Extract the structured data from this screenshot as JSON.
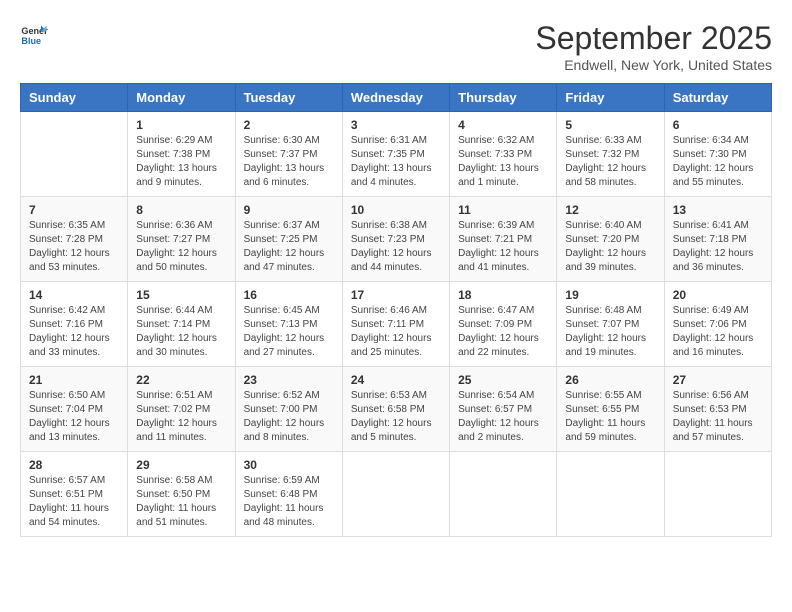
{
  "header": {
    "logo_general": "General",
    "logo_blue": "Blue",
    "title": "September 2025",
    "subtitle": "Endwell, New York, United States"
  },
  "days_of_week": [
    "Sunday",
    "Monday",
    "Tuesday",
    "Wednesday",
    "Thursday",
    "Friday",
    "Saturday"
  ],
  "weeks": [
    [
      {
        "day": "",
        "info": ""
      },
      {
        "day": "1",
        "info": "Sunrise: 6:29 AM\nSunset: 7:38 PM\nDaylight: 13 hours\nand 9 minutes."
      },
      {
        "day": "2",
        "info": "Sunrise: 6:30 AM\nSunset: 7:37 PM\nDaylight: 13 hours\nand 6 minutes."
      },
      {
        "day": "3",
        "info": "Sunrise: 6:31 AM\nSunset: 7:35 PM\nDaylight: 13 hours\nand 4 minutes."
      },
      {
        "day": "4",
        "info": "Sunrise: 6:32 AM\nSunset: 7:33 PM\nDaylight: 13 hours\nand 1 minute."
      },
      {
        "day": "5",
        "info": "Sunrise: 6:33 AM\nSunset: 7:32 PM\nDaylight: 12 hours\nand 58 minutes."
      },
      {
        "day": "6",
        "info": "Sunrise: 6:34 AM\nSunset: 7:30 PM\nDaylight: 12 hours\nand 55 minutes."
      }
    ],
    [
      {
        "day": "7",
        "info": "Sunrise: 6:35 AM\nSunset: 7:28 PM\nDaylight: 12 hours\nand 53 minutes."
      },
      {
        "day": "8",
        "info": "Sunrise: 6:36 AM\nSunset: 7:27 PM\nDaylight: 12 hours\nand 50 minutes."
      },
      {
        "day": "9",
        "info": "Sunrise: 6:37 AM\nSunset: 7:25 PM\nDaylight: 12 hours\nand 47 minutes."
      },
      {
        "day": "10",
        "info": "Sunrise: 6:38 AM\nSunset: 7:23 PM\nDaylight: 12 hours\nand 44 minutes."
      },
      {
        "day": "11",
        "info": "Sunrise: 6:39 AM\nSunset: 7:21 PM\nDaylight: 12 hours\nand 41 minutes."
      },
      {
        "day": "12",
        "info": "Sunrise: 6:40 AM\nSunset: 7:20 PM\nDaylight: 12 hours\nand 39 minutes."
      },
      {
        "day": "13",
        "info": "Sunrise: 6:41 AM\nSunset: 7:18 PM\nDaylight: 12 hours\nand 36 minutes."
      }
    ],
    [
      {
        "day": "14",
        "info": "Sunrise: 6:42 AM\nSunset: 7:16 PM\nDaylight: 12 hours\nand 33 minutes."
      },
      {
        "day": "15",
        "info": "Sunrise: 6:44 AM\nSunset: 7:14 PM\nDaylight: 12 hours\nand 30 minutes."
      },
      {
        "day": "16",
        "info": "Sunrise: 6:45 AM\nSunset: 7:13 PM\nDaylight: 12 hours\nand 27 minutes."
      },
      {
        "day": "17",
        "info": "Sunrise: 6:46 AM\nSunset: 7:11 PM\nDaylight: 12 hours\nand 25 minutes."
      },
      {
        "day": "18",
        "info": "Sunrise: 6:47 AM\nSunset: 7:09 PM\nDaylight: 12 hours\nand 22 minutes."
      },
      {
        "day": "19",
        "info": "Sunrise: 6:48 AM\nSunset: 7:07 PM\nDaylight: 12 hours\nand 19 minutes."
      },
      {
        "day": "20",
        "info": "Sunrise: 6:49 AM\nSunset: 7:06 PM\nDaylight: 12 hours\nand 16 minutes."
      }
    ],
    [
      {
        "day": "21",
        "info": "Sunrise: 6:50 AM\nSunset: 7:04 PM\nDaylight: 12 hours\nand 13 minutes."
      },
      {
        "day": "22",
        "info": "Sunrise: 6:51 AM\nSunset: 7:02 PM\nDaylight: 12 hours\nand 11 minutes."
      },
      {
        "day": "23",
        "info": "Sunrise: 6:52 AM\nSunset: 7:00 PM\nDaylight: 12 hours\nand 8 minutes."
      },
      {
        "day": "24",
        "info": "Sunrise: 6:53 AM\nSunset: 6:58 PM\nDaylight: 12 hours\nand 5 minutes."
      },
      {
        "day": "25",
        "info": "Sunrise: 6:54 AM\nSunset: 6:57 PM\nDaylight: 12 hours\nand 2 minutes."
      },
      {
        "day": "26",
        "info": "Sunrise: 6:55 AM\nSunset: 6:55 PM\nDaylight: 11 hours\nand 59 minutes."
      },
      {
        "day": "27",
        "info": "Sunrise: 6:56 AM\nSunset: 6:53 PM\nDaylight: 11 hours\nand 57 minutes."
      }
    ],
    [
      {
        "day": "28",
        "info": "Sunrise: 6:57 AM\nSunset: 6:51 PM\nDaylight: 11 hours\nand 54 minutes."
      },
      {
        "day": "29",
        "info": "Sunrise: 6:58 AM\nSunset: 6:50 PM\nDaylight: 11 hours\nand 51 minutes."
      },
      {
        "day": "30",
        "info": "Sunrise: 6:59 AM\nSunset: 6:48 PM\nDaylight: 11 hours\nand 48 minutes."
      },
      {
        "day": "",
        "info": ""
      },
      {
        "day": "",
        "info": ""
      },
      {
        "day": "",
        "info": ""
      },
      {
        "day": "",
        "info": ""
      }
    ]
  ]
}
